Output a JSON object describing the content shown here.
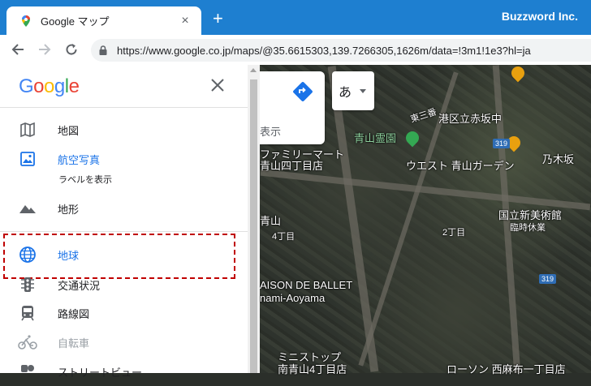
{
  "browser": {
    "tab_title": "Google マップ",
    "new_tab": "+",
    "close_tab": "×",
    "brand": "Buzzword Inc.",
    "url": "https://www.google.co.jp/maps/@35.6615303,139.7266305,1626m/data=!3m1!1e3?hl=ja"
  },
  "panel": {
    "logo": [
      "G",
      "o",
      "o",
      "g",
      "l",
      "e"
    ],
    "logo_colors": [
      "#4285F4",
      "#EA4335",
      "#FBBC05",
      "#4285F4",
      "#34A853",
      "#EA4335"
    ],
    "close": "×",
    "items": [
      {
        "label": "地図",
        "icon": "map-icon"
      },
      {
        "label": "航空写真",
        "icon": "satellite-icon",
        "state": "active"
      },
      {
        "label": "地形",
        "icon": "terrain-icon"
      },
      {
        "label": "地球",
        "icon": "globe-icon",
        "state": "active"
      },
      {
        "label": "交通状況",
        "icon": "traffic-icon"
      },
      {
        "label": "路線図",
        "icon": "transit-icon"
      },
      {
        "label": "自転車",
        "icon": "bicycle-icon",
        "state": "disabled"
      },
      {
        "label": "ストリートビュー",
        "icon": "streetview-icon"
      }
    ],
    "sublabel": "ラベルを表示"
  },
  "map": {
    "lang_button": "あ",
    "card_hint": "表示",
    "labels": {
      "l1": "港区立赤坂中",
      "l2": "青山霊園",
      "l3": "ウエスト 青山ガーデン",
      "l4": "乃木坂",
      "l5": "青山四丁目店",
      "l6": "ファミリーマート",
      "l7": "国立新美術館",
      "l8": "臨時休業",
      "l9": "4丁目",
      "l10": "2丁目",
      "l11": "AISON DE BALLET",
      "l12": "nami-Aoyama",
      "l13": "ミニストップ",
      "l14": "南青山4丁目店",
      "l15": "ローソン 西麻布一丁目店",
      "l16": "東三番",
      "l17": "青山",
      "b1": "319",
      "b2": "319"
    }
  },
  "colors": {
    "tab_strip": "#1e7fd0",
    "active_blue": "#1a73e8",
    "highlight": "#c00000"
  }
}
